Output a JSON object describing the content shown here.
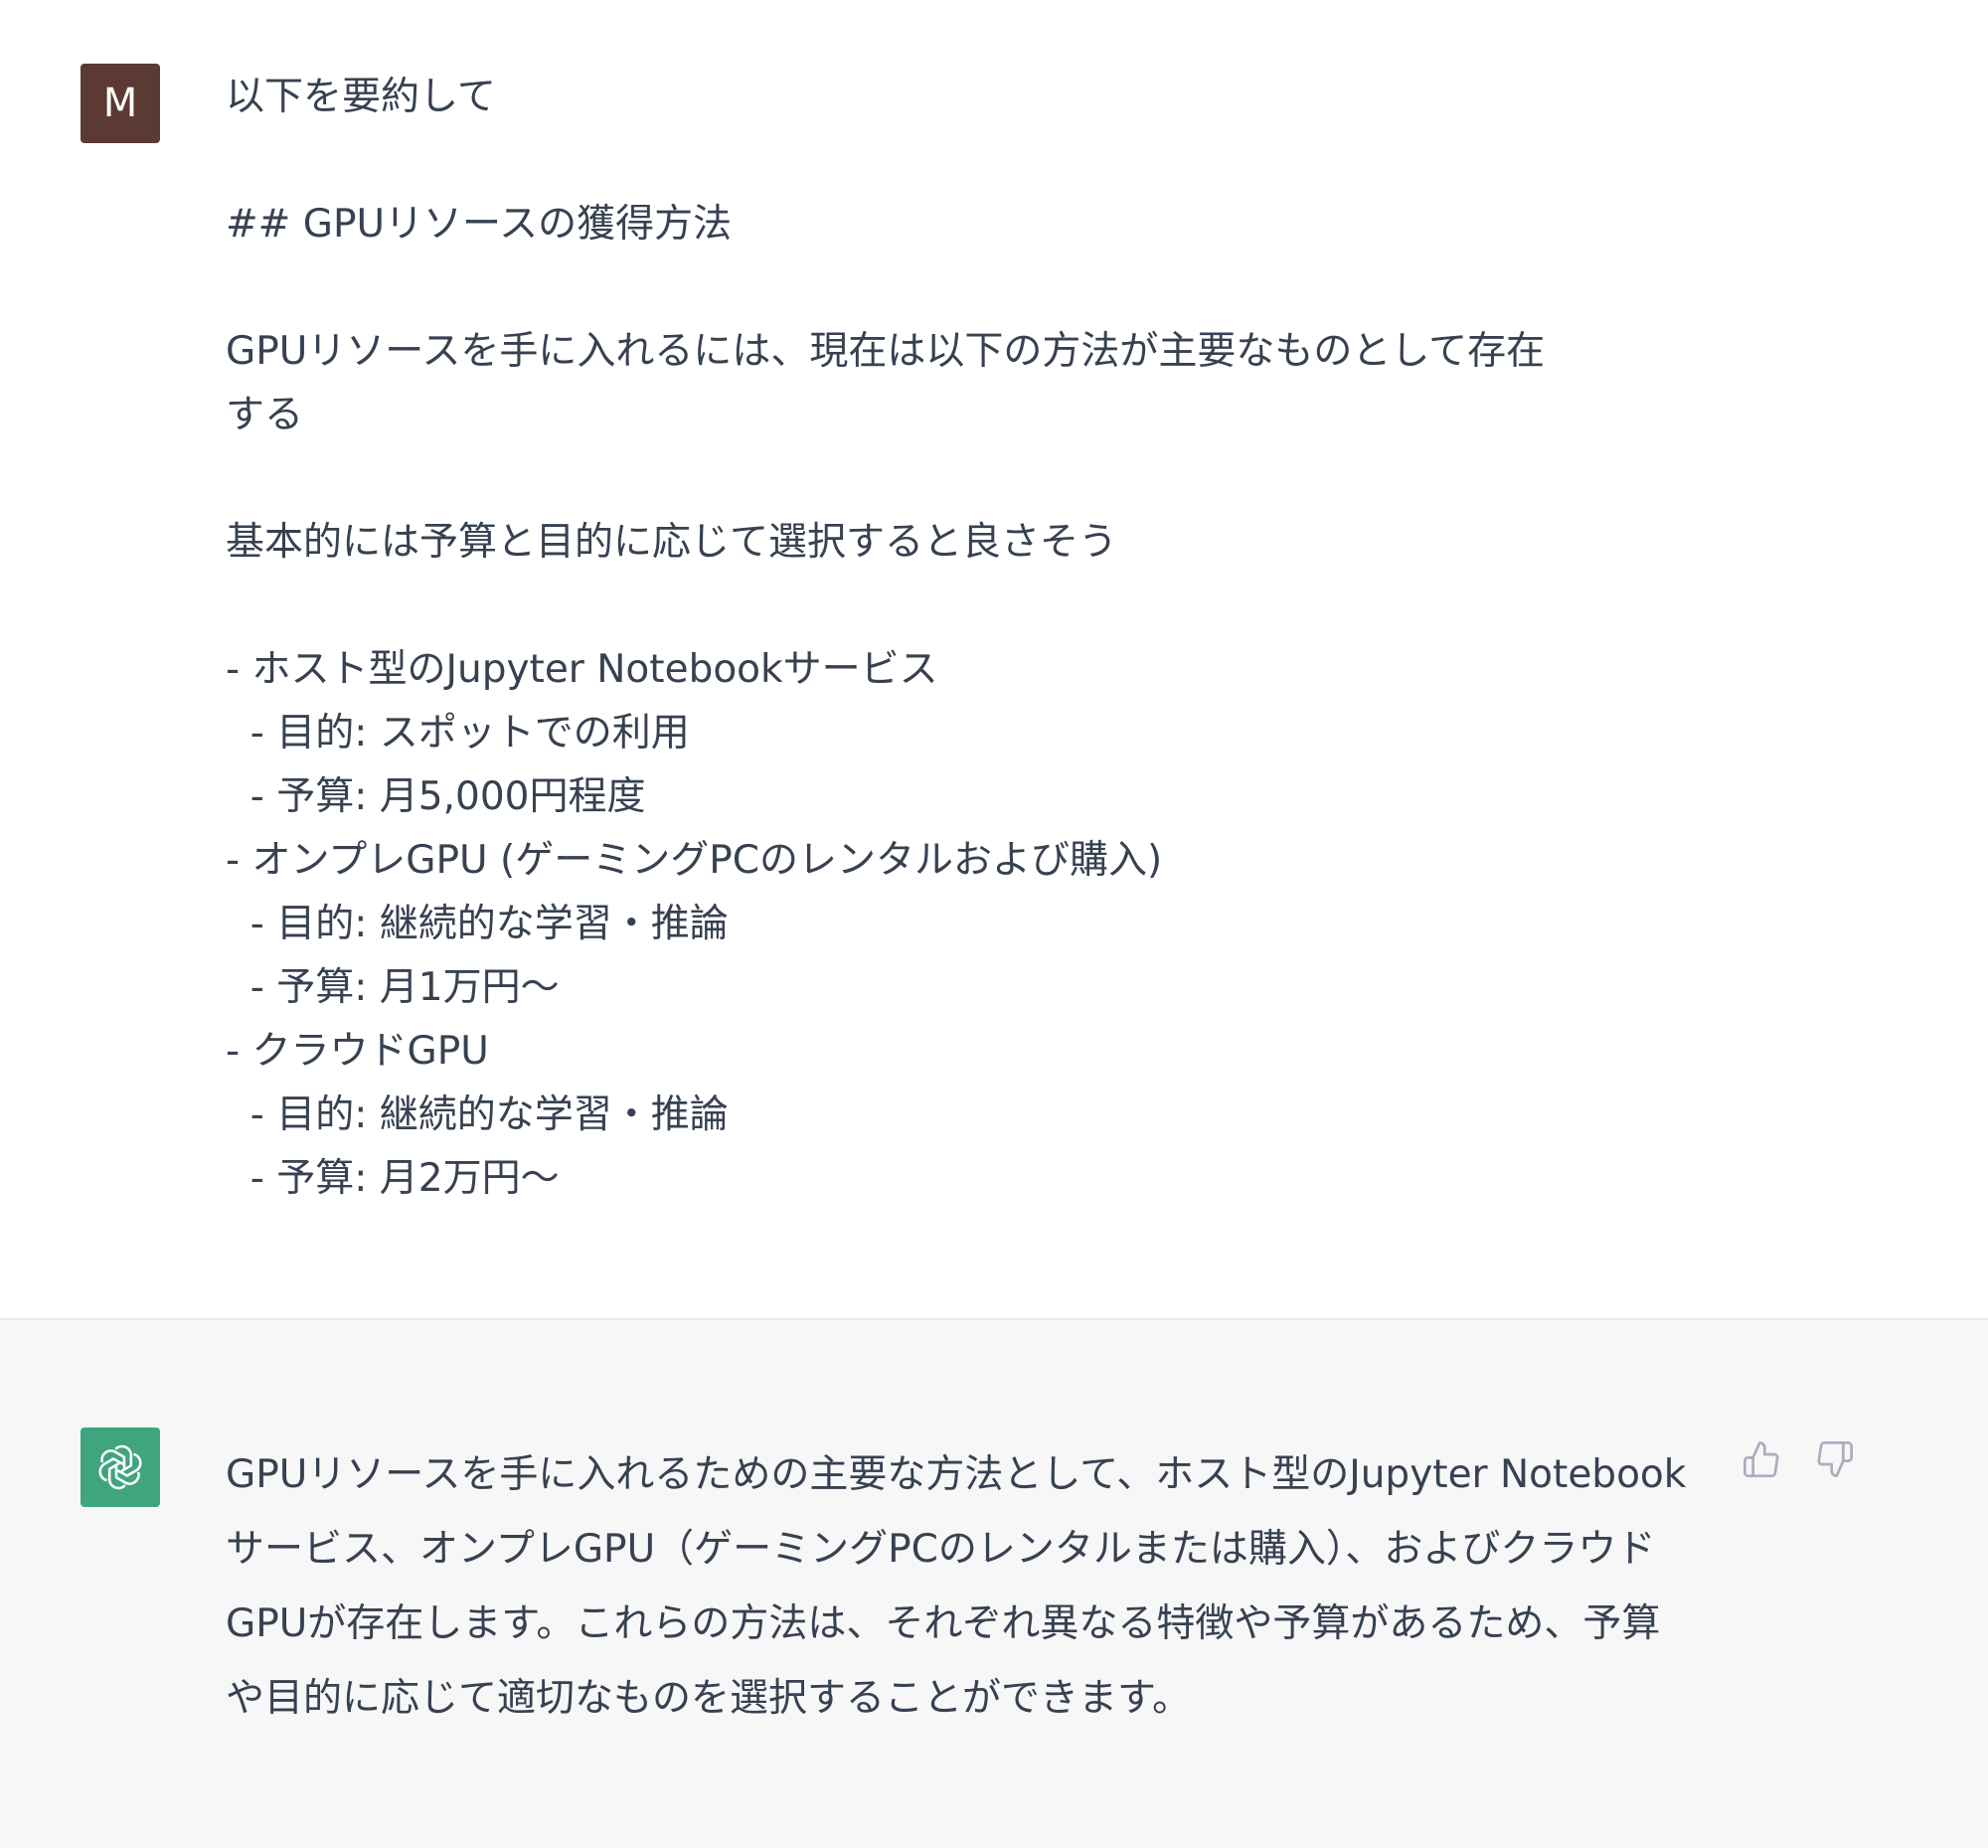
{
  "user_message": {
    "avatar_initial": "M",
    "avatar_color": "#5b3a33",
    "text": "以下を要約して\n\n## GPUリソースの獲得方法\n\nGPUリソースを手に入れるには、現在は以下の方法が主要なものとして存在\nする\n\n基本的には予算と目的に応じて選択すると良さそう\n\n- ホスト型のJupyter Notebookサービス\n  - 目的: スポットでの利用\n  - 予算: 月5,000円程度\n- オンプレGPU (ゲーミングPCのレンタルおよび購入)\n  - 目的: 継続的な学習・推論\n  - 予算: 月1万円〜\n- クラウドGPU\n  - 目的: 継続的な学習・推論\n  - 予算: 月2万円〜"
  },
  "assistant_message": {
    "avatar_icon": "openai-logo-icon",
    "avatar_color": "#3fa57f",
    "text": "GPUリソースを手に入れるための主要な方法として、ホスト型のJupyter Notebookサービス、オンプレGPU（ゲーミングPCのレンタルまたは購入）、およびクラウドGPUが存在します。これらの方法は、それぞれ異なる特徴や予算があるため、予算や目的に応じて適切なものを選択することができます。",
    "feedback": {
      "thumbs_up_icon": "thumbs-up-icon",
      "thumbs_down_icon": "thumbs-down-icon"
    }
  },
  "colors": {
    "user_background": "#ffffff",
    "assistant_background": "#f7f7f8",
    "text": "#374151",
    "icon": "#acacbe"
  }
}
